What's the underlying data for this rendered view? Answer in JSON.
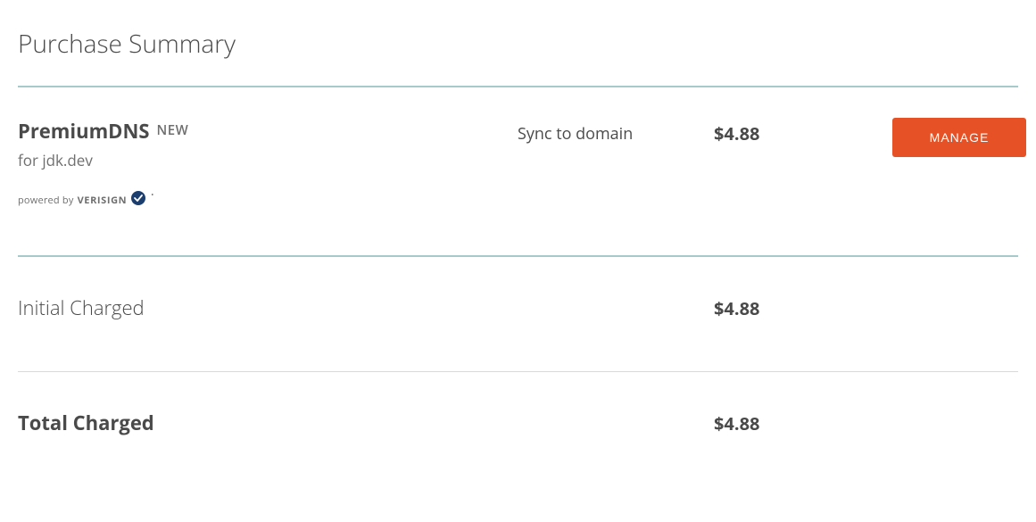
{
  "title": "Purchase Summary",
  "item": {
    "name": "PremiumDNS",
    "badge": "NEW",
    "for_prefix": "for ",
    "domain": "jdk.dev",
    "powered_by": "powered by",
    "powered_brand": "VERISIGN",
    "duration": "Sync to domain",
    "price": "$4.88",
    "action": "MANAGE"
  },
  "initial": {
    "label": "Initial Charged",
    "price": "$4.88"
  },
  "total": {
    "label": "Total Charged",
    "price": "$4.88"
  }
}
